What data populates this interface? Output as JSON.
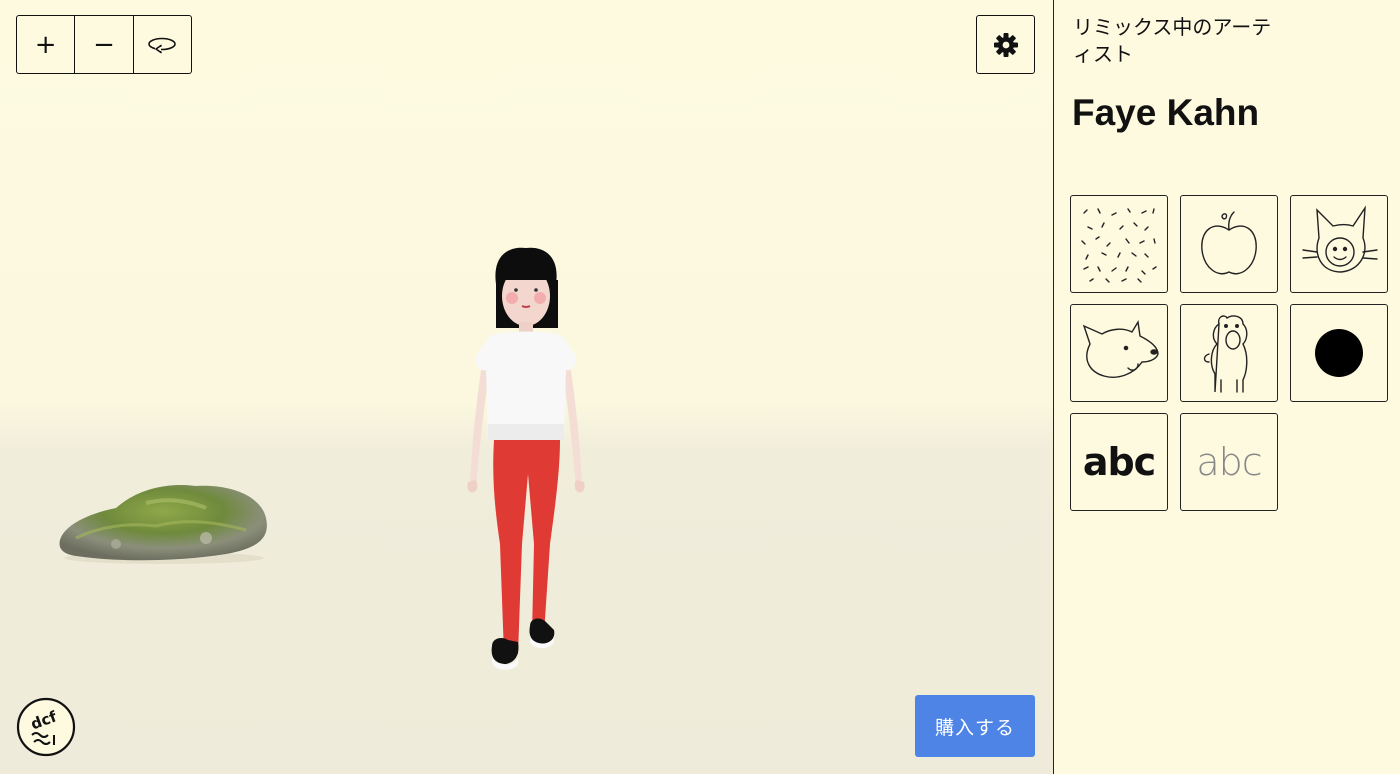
{
  "viewport": {
    "zoom_in_label": "+",
    "zoom_out_label": "−",
    "reset_icon": "rotate-reset-icon",
    "settings_icon": "gear-icon",
    "buy_label": "購入する",
    "logo_text": "dcf"
  },
  "sidebar": {
    "remix_label": "リミックス中のアーティスト",
    "artist_name": "Faye Kahn",
    "brushes": [
      {
        "icon": "scribble-pattern-icon"
      },
      {
        "icon": "apple-icon"
      },
      {
        "icon": "cat-face-icon"
      },
      {
        "icon": "dog-head-icon"
      },
      {
        "icon": "bear-figure-icon"
      },
      {
        "icon": "black-dot-icon"
      },
      {
        "icon": "abc-bold-font-icon",
        "text": "abc"
      },
      {
        "icon": "abc-thin-font-icon",
        "text": "abc"
      }
    ]
  },
  "colors": {
    "background": "#fdfae0",
    "accent": "#4d84e6",
    "border": "#111111"
  }
}
